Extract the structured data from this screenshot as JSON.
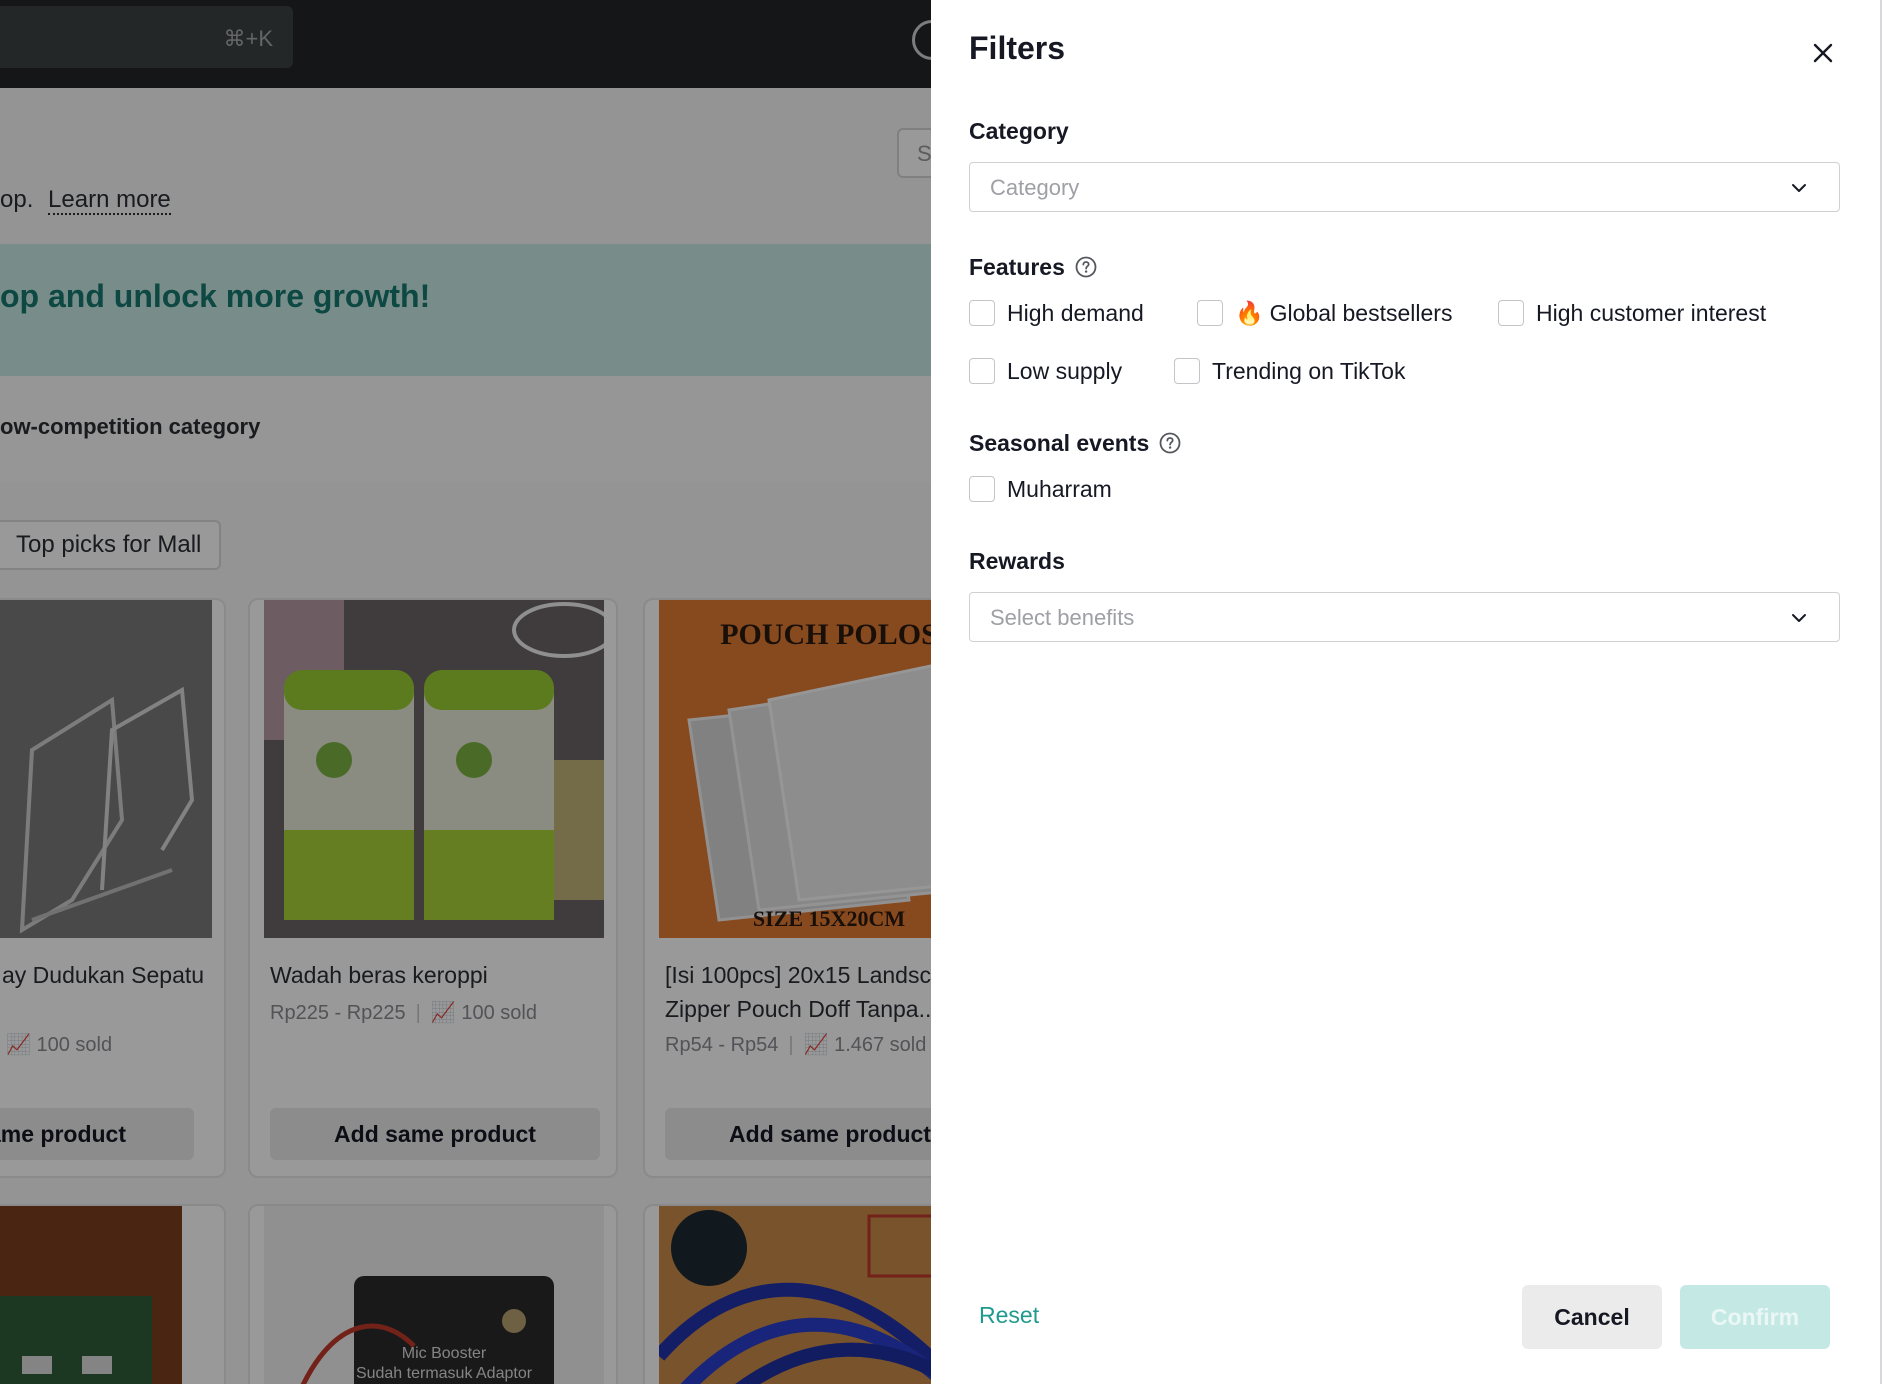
{
  "background": {
    "search_shortcut": "⌘+K",
    "right_search_placeholder": "S",
    "notice_text": "op.",
    "learn_more": "Learn more",
    "banner_text": "op and unlock more growth!",
    "low_competition_text": "ow-competition category",
    "chip_label": "Top picks for Mall",
    "cards": [
      {
        "title": "ay Dudukan Sepatu",
        "price": "",
        "sold": "100 sold",
        "button": "ame product"
      },
      {
        "title": "Wadah beras keroppi",
        "price": "Rp225 - Rp225",
        "sold": "100 sold",
        "button": "Add same product"
      },
      {
        "title": "[Isi 100pcs] 20x15 Landsca Zipper Pouch Doff Tanpa...",
        "price": "Rp54 - Rp54",
        "sold": "1.467 sold",
        "button": "Add same product",
        "image_text_top": "POUCH POLOS",
        "image_text_bottom": "SIZE 15X20CM"
      }
    ],
    "bottom_card_texts": {
      "mic_line1": "Mic Booster",
      "mic_line2": "Sudah termasuk Adaptor"
    }
  },
  "drawer": {
    "title": "Filters",
    "category": {
      "label": "Category",
      "placeholder": "Category"
    },
    "features": {
      "label": "Features",
      "options": [
        "High demand",
        "Global bestsellers",
        "High customer interest",
        "Low supply",
        "Trending on TikTok"
      ]
    },
    "seasonal": {
      "label": "Seasonal events",
      "options": [
        "Muharram"
      ]
    },
    "rewards": {
      "label": "Rewards",
      "placeholder": "Select benefits"
    },
    "footer": {
      "reset": "Reset",
      "cancel": "Cancel",
      "confirm": "Confirm"
    }
  },
  "colors": {
    "accent": "#1e9a8f",
    "confirm_disabled": "#c4e9e5",
    "banner": "#c9ebe6"
  }
}
